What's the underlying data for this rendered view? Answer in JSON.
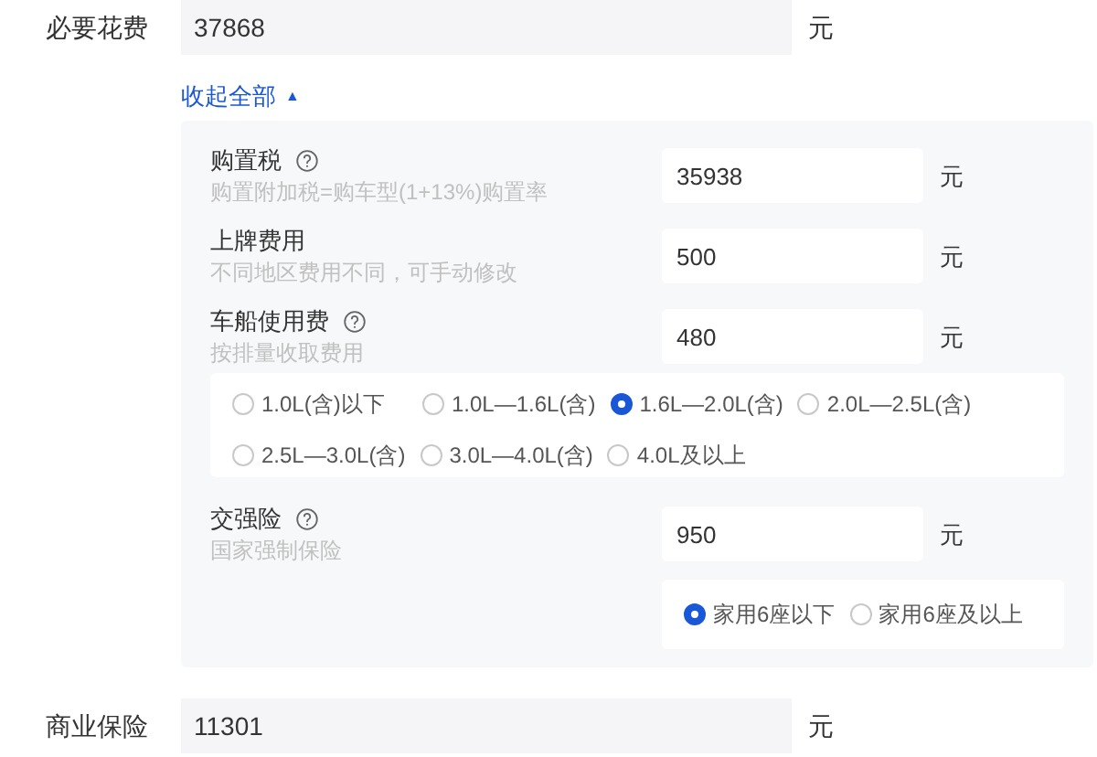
{
  "required_cost": {
    "label": "必要花费",
    "value": "37868",
    "unit": "元"
  },
  "collapse_link": {
    "label": "收起全部",
    "icon": "▲"
  },
  "items": [
    {
      "label": "购置税",
      "help": true,
      "hint": "购置附加税=购车型(1+13%)购置率",
      "value": "35938",
      "unit": "元"
    },
    {
      "label": "上牌费用",
      "help": false,
      "hint": "不同地区费用不同，可手动修改",
      "value": "500",
      "unit": "元"
    },
    {
      "label": "车船使用费",
      "help": true,
      "hint": "按排量收取费用",
      "value": "480",
      "unit": "元",
      "options": [
        {
          "label": "1.0L(含)以下",
          "selected": false
        },
        {
          "label": "1.0L—1.6L(含)",
          "selected": false
        },
        {
          "label": "1.6L—2.0L(含)",
          "selected": true
        },
        {
          "label": "2.0L—2.5L(含)",
          "selected": false
        },
        {
          "label": "2.5L—3.0L(含)",
          "selected": false
        },
        {
          "label": "3.0L—4.0L(含)",
          "selected": false
        },
        {
          "label": "4.0L及以上",
          "selected": false
        }
      ]
    },
    {
      "label": "交强险",
      "help": true,
      "hint": "国家强制保险",
      "value": "950",
      "unit": "元",
      "options": [
        {
          "label": "家用6座以下",
          "selected": true
        },
        {
          "label": "家用6座及以上",
          "selected": false
        }
      ]
    }
  ],
  "commercial_insurance": {
    "label": "商业保险",
    "value": "11301",
    "unit": "元"
  }
}
